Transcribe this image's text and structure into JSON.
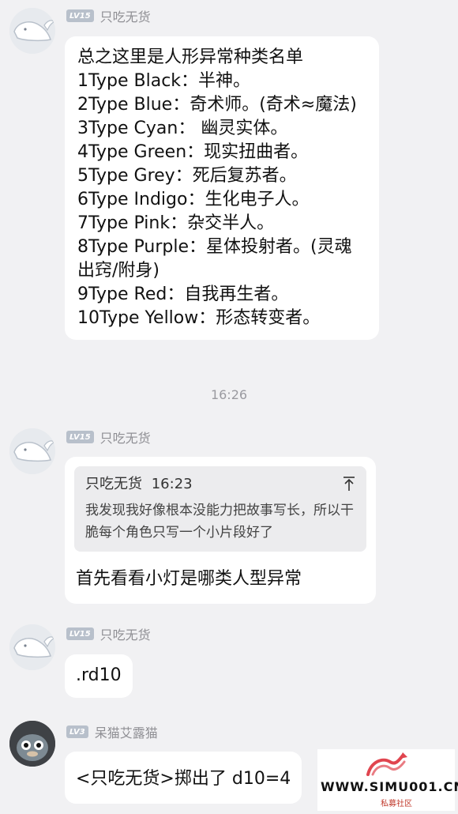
{
  "messages": [
    {
      "level": "LV15",
      "nick": "只吃无货",
      "lines": [
        "总之这里是人形异常种类名单",
        "1Type Black：半神。",
        "2Type Blue：奇术师。(奇术≈魔法)",
        "3Type Cyan： 幽灵实体。",
        "4Type Green：现实扭曲者。",
        "5Type Grey：死后复苏者。",
        "6Type Indigo：生化电子人。",
        "7Type Pink：杂交半人。",
        "8Type Purple：星体投射者。(灵魂出窍/附身)",
        "9Type Red：自我再生者。",
        "10Type Yellow：形态转变者。"
      ]
    },
    {
      "level": "LV15",
      "nick": "只吃无货",
      "quote": {
        "author": "只吃无货",
        "time": "16:23",
        "text": "我发现我好像根本没能力把故事写长，所以干脆每个角色只写一个小片段好了"
      },
      "text": "首先看看小灯是哪类人型异常"
    },
    {
      "level": "LV15",
      "nick": "只吃无货",
      "text": ".rd10"
    },
    {
      "level": "LV3",
      "nick": "呆猫艾露猫",
      "text": "<只吃无货>掷出了 d10=4"
    }
  ],
  "timestamp": "16:26",
  "watermark": {
    "text": "WWW.SIMU001.CN",
    "sub": "私募社区"
  },
  "colors": {
    "background": "#f1f1f3",
    "bubble": "#ffffff",
    "level_badge": "#b8c0cb",
    "nickname": "#8f8f94",
    "quote_bg": "#ececee",
    "watermark_red": "#e0454f"
  }
}
